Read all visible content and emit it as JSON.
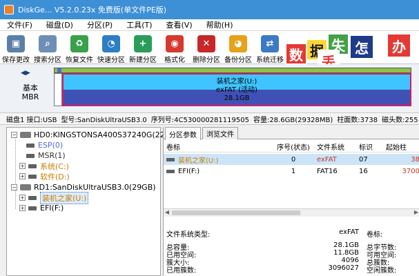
{
  "titlebar": {
    "title": "DiskGe... V5.2.0.23x 免费版(单文件PE版)"
  },
  "menu": [
    "文件(F)",
    "磁盘(D)",
    "分区(P)",
    "工具(T)",
    "查看(V)",
    "帮助(H)"
  ],
  "toolbar": [
    {
      "label": "保存更改",
      "icon": "save-icon",
      "color": "#5b7fa6",
      "glyph": "▣"
    },
    {
      "label": "搜索分区",
      "icon": "search-partition-icon",
      "color": "#6d8fb5",
      "glyph": "⌕"
    },
    {
      "label": "恢复文件",
      "icon": "recover-files-icon",
      "color": "#3aa04a",
      "glyph": "♻"
    },
    {
      "label": "快速分区",
      "icon": "quick-partition-icon",
      "color": "#2d7ec4",
      "glyph": "◔"
    },
    {
      "label": "新建分区",
      "icon": "new-partition-icon",
      "color": "#2a9d5a",
      "glyph": "+"
    },
    {
      "label": "格式化",
      "icon": "format-icon",
      "color": "#d43a2f",
      "glyph": "◉"
    },
    {
      "label": "删除分区",
      "icon": "delete-partition-icon",
      "color": "#c62828",
      "glyph": "✕"
    },
    {
      "label": "备份分区",
      "icon": "backup-partition-icon",
      "color": "#e6a21a",
      "glyph": "◕"
    },
    {
      "label": "系统迁移",
      "icon": "system-migrate-icon",
      "color": "#3b7ac4",
      "glyph": "⇄"
    }
  ],
  "tiles": [
    {
      "char": "数",
      "bg": "#e53935",
      "fg": "#ffffff"
    },
    {
      "char": "据",
      "bg": "#fdd835",
      "fg": "#1a1a1a"
    },
    {
      "char": "失",
      "bg": "#43a047",
      "fg": "#ffffff"
    },
    {
      "char": "丢",
      "bg": "#ffffff",
      "fg": "#e53935"
    },
    {
      "char": "怎",
      "bg": "#1e3a8a",
      "fg": "#ffffff"
    },
    {
      "char": "办",
      "bg": "#e53935",
      "fg": "#ffffff"
    }
  ],
  "diskmap": {
    "basic_line1": "基本",
    "basic_line2": "MBR",
    "partition_name": "装机之家(U:)",
    "partition_fs": "exFAT (活动)",
    "partition_size": "28.1GB"
  },
  "infoline": {
    "disk": "磁盘1 接口:USB",
    "model": "型号:SanDiskUltraUSB3.0",
    "serial": "序列号:4C530000281119505",
    "capacity": "容量:28.6GB(29328MB)",
    "cylinders": "柱面数:3738",
    "heads": "磁头数:255"
  },
  "tree": {
    "disk0": "HD0:KINGSTONSA400S37240G(22",
    "disk0_parts": [
      {
        "label": "ESP(0)",
        "color": "#4a6fd8"
      },
      {
        "label": "MSR(1)",
        "color": "#333333"
      },
      {
        "label": "系统(C:)",
        "color": "#c77d00"
      },
      {
        "label": "软件(D:)",
        "color": "#c77d00"
      }
    ],
    "disk1": "RD1:SanDiskUltraUSB3.0(29GB)",
    "disk1_parts": [
      {
        "label": "装机之家(U:)",
        "color": "#c77d00"
      },
      {
        "label": "EFI(F:)",
        "color": "#1a1a1a"
      }
    ]
  },
  "tabs": [
    "分区参数",
    "浏览文件"
  ],
  "table": {
    "headers": [
      "卷标",
      "序号(状态)",
      "文件系统",
      "标识",
      "起始柱"
    ],
    "rows": [
      {
        "label": "装机之家(U:)",
        "index": "0",
        "fs": "exFAT",
        "id": "07",
        "start": "38"
      },
      {
        "label": "EFI(F:)",
        "index": "1",
        "fs": "FAT16",
        "id": "16",
        "start": "3700"
      }
    ]
  },
  "stats": [
    {
      "label": "文件系统类型:",
      "value": "exFAT",
      "label2": "卷标:"
    },
    {
      "label": "总容量:",
      "value": "28.1GB",
      "label2": "总字节数:"
    },
    {
      "label": "已用空间:",
      "value": "11.8GB",
      "label2": "可用空间:"
    },
    {
      "label": "簇大小:",
      "value": "4096",
      "label2": "总簇数:"
    },
    {
      "label": "已用簇数:",
      "value": "3096027",
      "label2": "空闲簇数:"
    }
  ]
}
